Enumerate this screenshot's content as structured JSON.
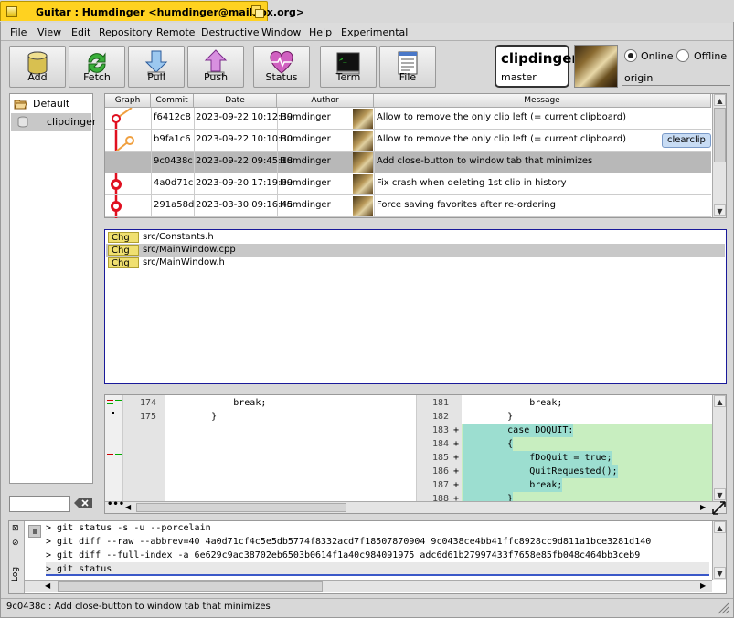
{
  "window": {
    "title": "Guitar : Humdinger <humdinger@mailbox.org>"
  },
  "menu": [
    "File",
    "View",
    "Edit",
    "Repository",
    "Remote",
    "Destructive",
    "Window",
    "Help",
    "Experimental"
  ],
  "toolbar": [
    {
      "label": "Add",
      "icon": "database-add-icon"
    },
    {
      "label": "Fetch",
      "icon": "fetch-arrows-icon"
    },
    {
      "label": "Pull",
      "icon": "pull-arrow-icon"
    },
    {
      "label": "Push",
      "icon": "push-arrow-icon"
    },
    {
      "label": "Status",
      "icon": "heart-pulse-icon"
    },
    {
      "label": "Term",
      "icon": "terminal-icon"
    },
    {
      "label": "File",
      "icon": "file-list-icon"
    }
  ],
  "repo": {
    "name": "clipdinger",
    "branch": "master",
    "remote": "origin",
    "online_label": "Online",
    "offline_label": "Offline",
    "mode": "Online"
  },
  "sidebar": {
    "items": [
      {
        "label": "Default",
        "type": "group"
      },
      {
        "label": "clipdinger",
        "type": "repo",
        "selected": true
      }
    ],
    "filter_value": ""
  },
  "commits": {
    "headers": [
      "Graph",
      "Commit",
      "Date",
      "Author",
      "Message"
    ],
    "rows": [
      {
        "hash": "f6412c8",
        "date": "2023-09-22 10:12:39",
        "author": "Humdinger",
        "message": "Allow to remove the only clip left (= current clipboard)",
        "tag": ""
      },
      {
        "hash": "b9fa1c6",
        "date": "2023-09-22 10:10:30",
        "author": "Humdinger",
        "message": "Allow to remove the only clip left (= current clipboard)",
        "tag": "clearclip"
      },
      {
        "hash": "9c0438c",
        "date": "2023-09-22 09:45:18",
        "author": "Humdinger",
        "message": "Add close-button to window tab that minimizes",
        "tag": "",
        "selected": true
      },
      {
        "hash": "4a0d71c",
        "date": "2023-09-20 17:19:09",
        "author": "Humdinger",
        "message": "Fix crash when deleting 1st clip in history",
        "tag": ""
      },
      {
        "hash": "291a58d",
        "date": "2023-03-30 09:16:45",
        "author": "Humdinger",
        "message": "Force saving favorites after re-ordering",
        "tag": ""
      }
    ]
  },
  "files": [
    {
      "status": "Chg",
      "path": "src/Constants.h"
    },
    {
      "status": "Chg",
      "path": "src/MainWindow.cpp",
      "selected": true
    },
    {
      "status": "Chg",
      "path": "src/MainWindow.h"
    }
  ],
  "diff": {
    "left": [
      {
        "num": "174",
        "code": "            break;"
      },
      {
        "num": "175",
        "code": "        }"
      }
    ],
    "right": [
      {
        "num": "181",
        "mark": "",
        "code": "            break;",
        "added": false
      },
      {
        "num": "182",
        "mark": "",
        "code": "        }",
        "added": false
      },
      {
        "num": "183",
        "mark": "+",
        "code": "        case DOQUIT:",
        "added": true
      },
      {
        "num": "184",
        "mark": "+",
        "code": "        {",
        "added": true
      },
      {
        "num": "185",
        "mark": "+",
        "code": "            fDoQuit = true;",
        "added": true
      },
      {
        "num": "186",
        "mark": "+",
        "code": "            QuitRequested();",
        "added": true
      },
      {
        "num": "187",
        "mark": "+",
        "code": "            break;",
        "added": true
      },
      {
        "num": "188",
        "mark": "+",
        "code": "        }",
        "added": true
      }
    ]
  },
  "log": {
    "tab_label": "Log",
    "lines": [
      "> git status -s -u --porcelain",
      "> git diff --raw --abbrev=40 4a0d71cf4c5e5db5774f8332acd7f18507870904 9c0438ce4bb41ffc8928cc9d811a1bce3281d140",
      "> git diff --full-index -a 6e629c9ac38702eb6503b0614f1a40c984091975 adc6d61b27997433f7658e85fb048c464bb3ceb9",
      "> git status"
    ]
  },
  "status_bar": "9c0438c : Add close-button to window tab that minimizes",
  "colors": {
    "title_tab": "#ffd220",
    "diff_added": "#c8eec0",
    "graph_red": "#e01020",
    "graph_orange": "#f0a040",
    "selection": "#b8b8b8"
  }
}
